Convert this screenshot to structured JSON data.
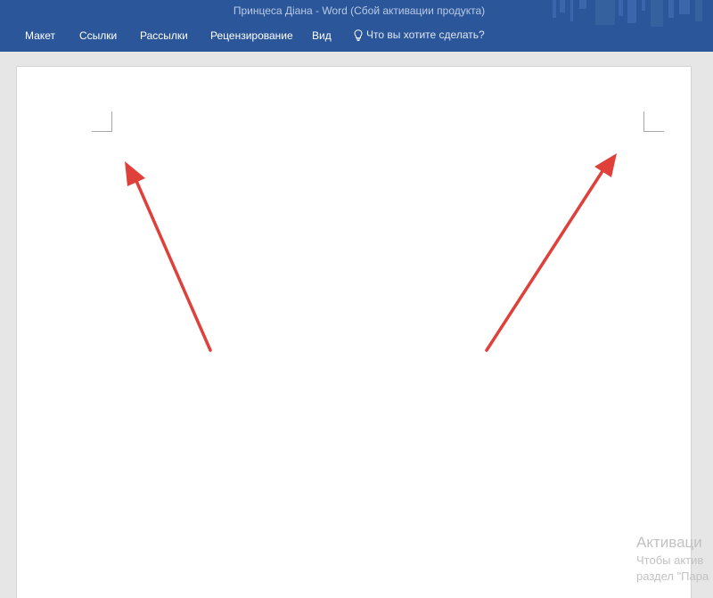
{
  "window": {
    "title": "Принцеса Діана - Word (Сбой активации продукта)"
  },
  "ribbon": {
    "tabs": [
      {
        "label": "Макет"
      },
      {
        "label": "Ссылки"
      },
      {
        "label": "Рассылки"
      },
      {
        "label": "Рецензирование"
      },
      {
        "label": "Вид"
      }
    ],
    "tell_me": {
      "icon": "lightbulb-icon",
      "label": "Что вы хотите сделать?"
    }
  },
  "watermark": {
    "title": "Активаци",
    "line1": "Чтобы актив",
    "line2": "раздел \"Пара"
  },
  "colors": {
    "ribbon": "#2b579a",
    "canvas": "#e6e6e6",
    "page": "#ffffff",
    "arrow": "#e0403a"
  }
}
